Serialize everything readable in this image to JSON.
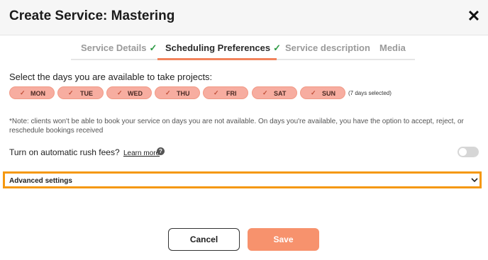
{
  "header": {
    "title": "Create Service: Mastering",
    "close_label": "✕"
  },
  "tabs": [
    {
      "label": "Service Details",
      "check": "✓"
    },
    {
      "label": "Scheduling Preferences",
      "check": "✓"
    },
    {
      "label": "Service description"
    },
    {
      "label": "Media"
    }
  ],
  "days": {
    "label": "Select the days you are available to take projects:",
    "items": [
      "MON",
      "TUE",
      "WED",
      "THU",
      "FRI",
      "SAT",
      "SUN"
    ],
    "check": "✓",
    "count": "(7 days selected)"
  },
  "note": "*Note: clients won't be able to book your service on days you are not available. On days you're available, you have the option to accept, reject, or reschedule bookings received",
  "rush": {
    "label": "Turn on automatic rush fees?",
    "learn_more": "Learn more",
    "help": "?",
    "enabled": false
  },
  "advanced": {
    "label": "Advanced settings"
  },
  "buttons": {
    "cancel": "Cancel",
    "save": "Save"
  },
  "colors": {
    "accent": "#f7926d",
    "highlight": "#f5980f",
    "day_chip": "#f7ada0",
    "check_green": "#2e9b45"
  }
}
